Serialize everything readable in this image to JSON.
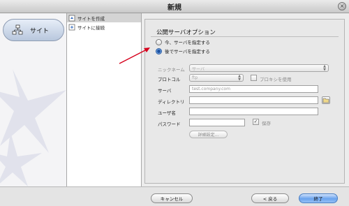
{
  "window": {
    "title": "新規"
  },
  "sidebar": {
    "site_button_label": "サイト"
  },
  "list": {
    "items": [
      {
        "label": "サイトを作成",
        "selected": true
      },
      {
        "label": "サイトに接続",
        "selected": false
      }
    ]
  },
  "panel": {
    "title": "公開サーバオプション",
    "radios": [
      {
        "label": "今、サーバを指定する",
        "selected": false
      },
      {
        "label": "後でサーバを指定する",
        "selected": true
      }
    ],
    "fields": {
      "nickname": {
        "label": "ニックネーム",
        "value": "サーバ"
      },
      "protocol": {
        "label": "プロトコル",
        "value": "ftp"
      },
      "proxy": {
        "label": "プロキシを使用",
        "checked": false
      },
      "server": {
        "label": "サーバ",
        "placeholder": "test.company.com"
      },
      "directory": {
        "label": "ディレクトリ",
        "value": ""
      },
      "username": {
        "label": "ユーザ名",
        "value": ""
      },
      "password": {
        "label": "パスワード",
        "value": ""
      },
      "save": {
        "label": "保存",
        "checked": true
      },
      "details_button": "詳細設定..."
    }
  },
  "footer": {
    "cancel": "キャンセル",
    "back": "< 戻る",
    "finish": "終了"
  },
  "colors": {
    "accent_arrow": "#d6001c",
    "default_button": "#6aa3ee"
  }
}
